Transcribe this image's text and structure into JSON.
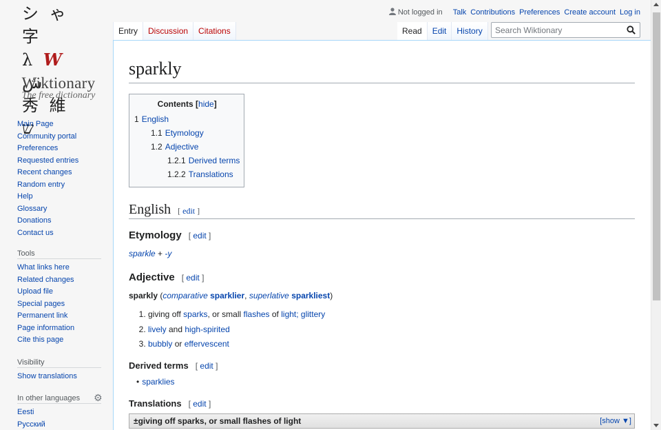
{
  "logo": {
    "glyph_line1": "シ ゃ 字",
    "glyph_line2_a": "λ ",
    "glyph_line2_w": "W",
    "glyph_line2_b": " ش",
    "glyph_line3": "秀 維 ש",
    "wordmark": "Wiktionary",
    "tagline": "The free dictionary"
  },
  "personal": {
    "status": "Not logged in",
    "links": [
      "Talk",
      "Contributions",
      "Preferences",
      "Create account",
      "Log in"
    ]
  },
  "tabs_left": [
    {
      "label": "Entry",
      "selected": true
    },
    {
      "label": "Discussion",
      "new": true
    },
    {
      "label": "Citations",
      "new": true
    }
  ],
  "tabs_right": [
    {
      "label": "Read",
      "selected": true
    },
    {
      "label": "Edit"
    },
    {
      "label": "History"
    }
  ],
  "search": {
    "placeholder": "Search Wiktionary"
  },
  "sidebar": {
    "nav": [
      "Main Page",
      "Community portal",
      "Preferences",
      "Requested entries",
      "Recent changes",
      "Random entry",
      "Help",
      "Glossary",
      "Donations",
      "Contact us"
    ],
    "tools_title": "Tools",
    "tools": [
      "What links here",
      "Related changes",
      "Upload file",
      "Special pages",
      "Permanent link",
      "Page information",
      "Cite this page"
    ],
    "visibility_title": "Visibility",
    "visibility": [
      "Show translations"
    ],
    "languages_title": "In other languages",
    "languages": [
      "Eesti",
      "Русский"
    ]
  },
  "page": {
    "title": "sparkly",
    "toc": {
      "title": "Contents",
      "hide": "hide",
      "entries": [
        {
          "num": "1",
          "label": "English",
          "level": 1
        },
        {
          "num": "1.1",
          "label": "Etymology",
          "level": 2
        },
        {
          "num": "1.2",
          "label": "Adjective",
          "level": 2
        },
        {
          "num": "1.2.1",
          "label": "Derived terms",
          "level": 3
        },
        {
          "num": "1.2.2",
          "label": "Translations",
          "level": 3
        }
      ]
    },
    "edit_label": "edit",
    "english": "English",
    "etymology_heading": "Etymology",
    "etymology": {
      "link1": "sparkle",
      "plus": " + ",
      "link2": "-y"
    },
    "adjective_heading": "Adjective",
    "headword": {
      "word": "sparkly",
      "comparative_label": "comparative",
      "comparative": "sparklier",
      "superlative_label": "superlative",
      "superlative": "sparkliest"
    },
    "senses": [
      [
        {
          "t": "giving off "
        },
        {
          "l": "sparks"
        },
        {
          "t": ", or small "
        },
        {
          "l": "flashes"
        },
        {
          "t": " of "
        },
        {
          "l": "light"
        },
        {
          "l": "; "
        },
        {
          "l": "glittery"
        }
      ],
      [
        {
          "l": "lively"
        },
        {
          "t": " and "
        },
        {
          "l": "high-spirited"
        }
      ],
      [
        {
          "l": "bubbly"
        },
        {
          "t": " or "
        },
        {
          "l": "effervescent"
        }
      ]
    ],
    "derived_heading": "Derived terms",
    "derived": [
      "sparklies"
    ],
    "translations_heading": "Translations",
    "translation_box": {
      "label": "±giving off sparks, or small flashes of light",
      "show": "[show ▼]"
    }
  }
}
